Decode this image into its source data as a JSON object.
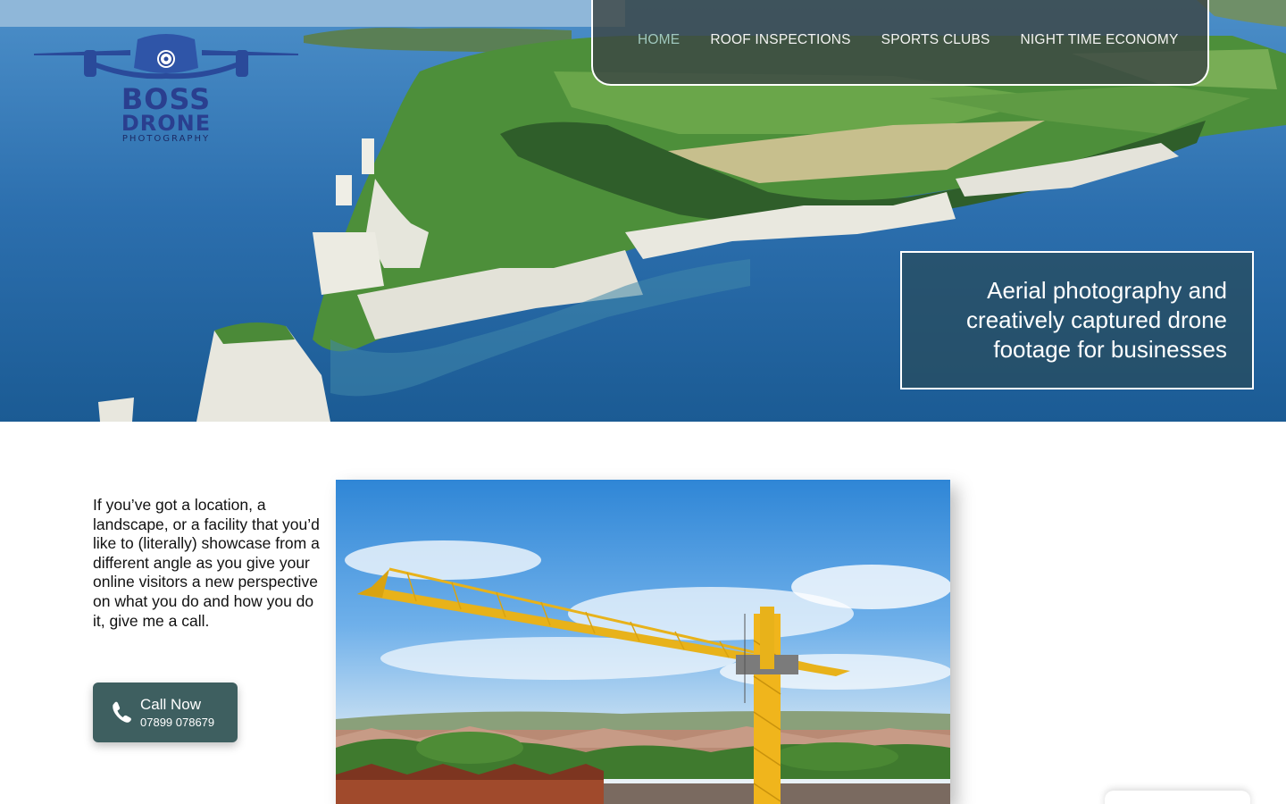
{
  "brand": {
    "line1": "BOSS",
    "line2": "DRONE",
    "line3": "PHOTOGRAPHY"
  },
  "nav": {
    "items": [
      {
        "label": "HOME",
        "active": true
      },
      {
        "label": "ROOF INSPECTIONS",
        "active": false
      },
      {
        "label": "SPORTS CLUBS",
        "active": false
      },
      {
        "label": "NIGHT TIME ECONOMY",
        "active": false
      }
    ]
  },
  "hero": {
    "tagline": "Aerial photography and creatively captured drone footage for businesses"
  },
  "intro": {
    "text": "If you’ve got a location, a landscape, or a facility that you’d like to (literally) showcase from a different angle as you give your online visitors a new perspective on what you do and how you do it, give me a call."
  },
  "call": {
    "label": "Call Now",
    "number": "07899 078679"
  },
  "colors": {
    "nav_active": "#9fc7bd",
    "button_bg": "#3e5f60",
    "logo_blue": "#2a3f8f"
  }
}
